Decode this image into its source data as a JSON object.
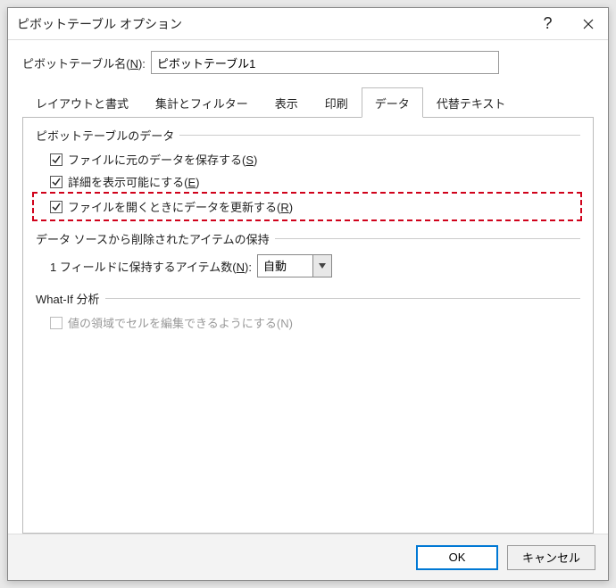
{
  "title": "ピボットテーブル オプション",
  "name_label_pre": "ピボットテーブル名(",
  "name_label_key": "N",
  "name_label_post": "):",
  "name_value": "ピボットテーブル1",
  "tabs": [
    {
      "label": "レイアウトと書式"
    },
    {
      "label": "集計とフィルター"
    },
    {
      "label": "表示"
    },
    {
      "label": "印刷"
    },
    {
      "label": "データ"
    },
    {
      "label": "代替テキスト"
    }
  ],
  "active_tab": 4,
  "group1": {
    "title": "ピボットテーブルのデータ",
    "cb1_pre": "ファイルに元のデータを保存する(",
    "cb1_key": "S",
    "cb1_post": ")",
    "cb2_pre": "詳細を表示可能にする(",
    "cb2_key": "E",
    "cb2_post": ")",
    "cb3_pre": "ファイルを開くときにデータを更新する(",
    "cb3_key": "R",
    "cb3_post": ")"
  },
  "group2": {
    "title": "データ ソースから削除されたアイテムの保持",
    "select_label_pre": "1 フィールドに保持するアイテム数(",
    "select_label_key": "N",
    "select_label_post": "):",
    "select_value": "自動"
  },
  "group3": {
    "title": "What-If 分析",
    "cb_label": "値の領域でセルを編集できるようにする(N)"
  },
  "ok_label": "OK",
  "cancel_label": "キャンセル"
}
